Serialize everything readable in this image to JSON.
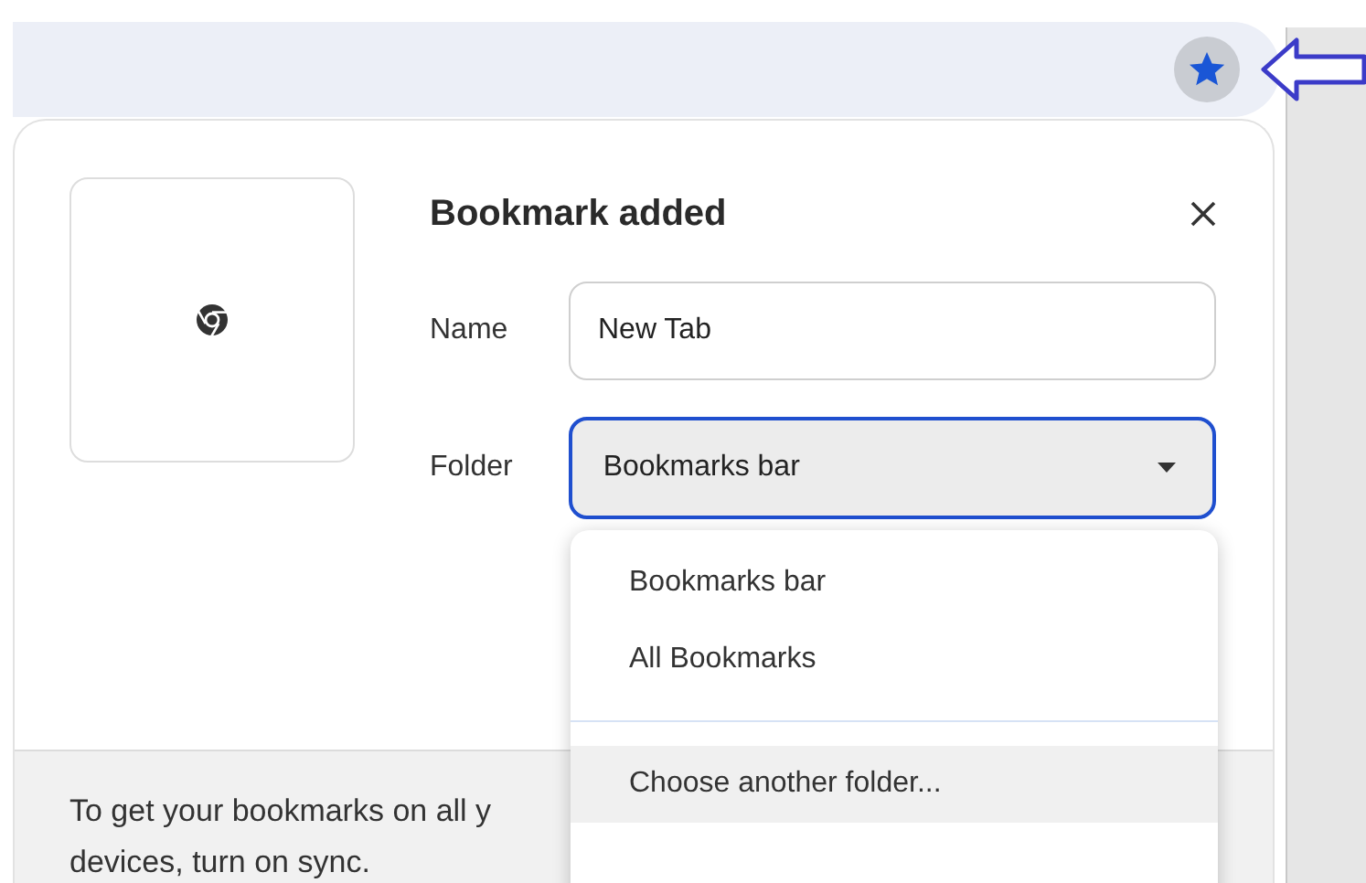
{
  "dialog": {
    "title": "Bookmark added",
    "fields": [
      {
        "label": "Name",
        "kind": "text",
        "value": "New Tab"
      },
      {
        "label": "Folder",
        "kind": "select",
        "value": "Bookmarks bar",
        "focused": true
      }
    ],
    "dropdown": {
      "items": [
        {
          "label": "Bookmarks bar",
          "selected": false
        },
        {
          "label": "All Bookmarks",
          "selected": false
        },
        {
          "kind": "divider"
        },
        {
          "label": "Choose another folder...",
          "selected": true
        }
      ]
    },
    "sync_prompt": [
      "To get your bookmarks on all y",
      "devices, turn on sync."
    ]
  },
  "toolbar": {
    "bookmarked": true
  }
}
